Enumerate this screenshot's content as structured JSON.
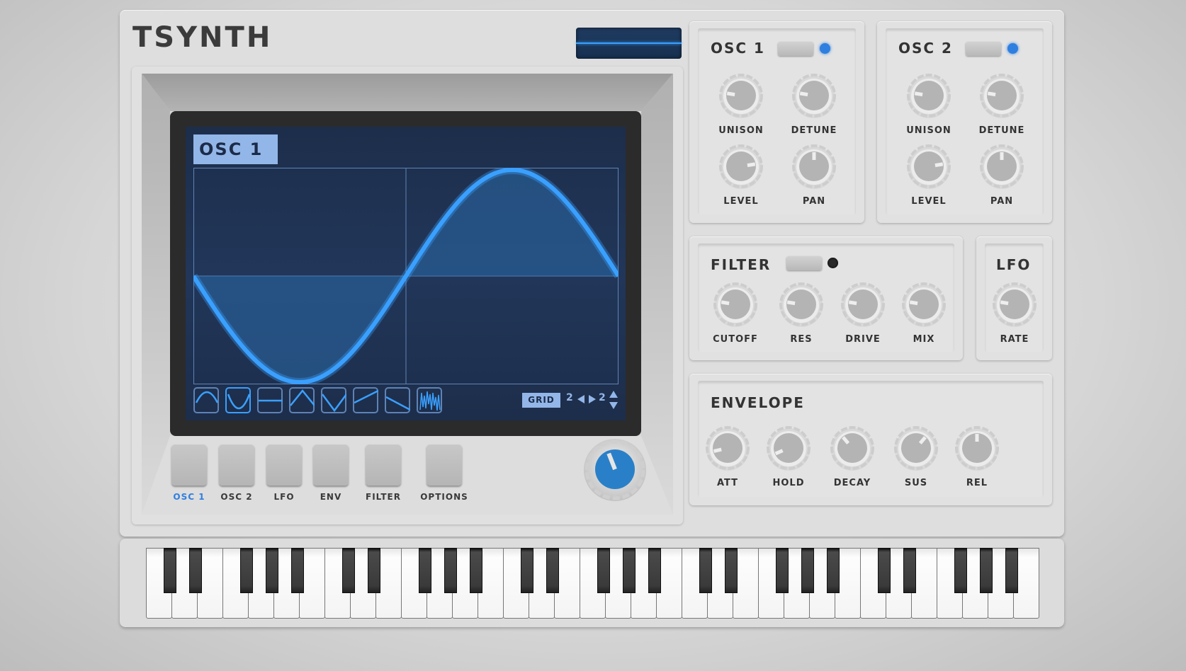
{
  "app": {
    "title": "TSYNTH"
  },
  "display": {
    "osc_label": "OSC 1",
    "waveform": "sine",
    "wave_buttons": [
      {
        "name": "sine",
        "selected": false
      },
      {
        "name": "inverted-sine",
        "selected": true
      },
      {
        "name": "flat",
        "selected": false
      },
      {
        "name": "triangle",
        "selected": false
      },
      {
        "name": "inverted-triangle",
        "selected": false
      },
      {
        "name": "saw-up",
        "selected": false
      },
      {
        "name": "saw-down",
        "selected": false
      },
      {
        "name": "noise",
        "selected": false
      }
    ],
    "grid_label": "GRID",
    "grid_x": "2",
    "grid_y": "2"
  },
  "nav_buttons": [
    {
      "label": "OSC 1",
      "active": true
    },
    {
      "label": "OSC 2",
      "active": false
    },
    {
      "label": "LFO",
      "active": false
    },
    {
      "label": "ENV",
      "active": false
    },
    {
      "label": "FILTER",
      "active": false
    },
    {
      "label": "OPTIONS",
      "active": false
    }
  ],
  "master_knob": {
    "value": 0.42,
    "color": "#2a80c8"
  },
  "osc1": {
    "title": "OSC 1",
    "led_on": true,
    "knobs": [
      {
        "label": "UNISON",
        "value": 0.2
      },
      {
        "label": "DETUNE",
        "value": 0.2
      },
      {
        "label": "LEVEL",
        "value": 0.8
      },
      {
        "label": "PAN",
        "value": 0.5
      }
    ]
  },
  "osc2": {
    "title": "OSC 2",
    "led_on": true,
    "knobs": [
      {
        "label": "UNISON",
        "value": 0.2
      },
      {
        "label": "DETUNE",
        "value": 0.2
      },
      {
        "label": "LEVEL",
        "value": 0.8
      },
      {
        "label": "PAN",
        "value": 0.5
      }
    ]
  },
  "filter": {
    "title": "FILTER",
    "led_on": false,
    "knobs": [
      {
        "label": "CUTOFF",
        "value": 0.2
      },
      {
        "label": "RES",
        "value": 0.2
      },
      {
        "label": "DRIVE",
        "value": 0.2
      },
      {
        "label": "MIX",
        "value": 0.2
      }
    ]
  },
  "lfo": {
    "title": "LFO",
    "knobs": [
      {
        "label": "RATE",
        "value": 0.2
      }
    ]
  },
  "envelope": {
    "title": "ENVELOPE",
    "knobs": [
      {
        "label": "ATT",
        "value": 0.12
      },
      {
        "label": "HOLD",
        "value": 0.08
      },
      {
        "label": "DECAY",
        "value": 0.35
      },
      {
        "label": "SUS",
        "value": 0.65
      },
      {
        "label": "REL",
        "value": 0.5
      }
    ]
  },
  "keyboard": {
    "octaves": 5,
    "start_note": "C",
    "end_note": "B"
  },
  "colors": {
    "accent": "#3aa0ff",
    "led_on": "#2f7fe0",
    "led_off": "#2a2a2a",
    "screen_bg": "#213659"
  }
}
